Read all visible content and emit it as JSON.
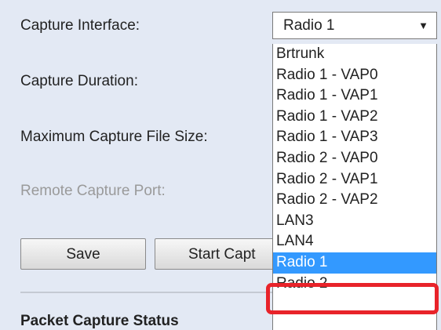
{
  "form": {
    "capture_interface_label": "Capture Interface:",
    "capture_duration_label": "Capture Duration:",
    "max_file_size_label": "Maximum Capture File Size:",
    "remote_port_label": "Remote Capture Port:"
  },
  "buttons": {
    "save": "Save",
    "start": "Start Capt"
  },
  "status": {
    "heading": "Packet Capture Status"
  },
  "select": {
    "value": "Radio 1",
    "arrow": "▼",
    "options": [
      "Brtrunk",
      "Radio 1 - VAP0",
      "Radio 1 - VAP1",
      "Radio 1 - VAP2",
      "Radio 1 - VAP3",
      "Radio 2 - VAP0",
      "Radio 2 - VAP1",
      "Radio 2 - VAP2",
      "LAN3",
      "LAN4",
      "Radio 1",
      "Radio 2"
    ],
    "highlighted_index": 10
  },
  "colors": {
    "page_bg": "#e3e9f4",
    "selected_bg": "#3399ff",
    "annotation_box": "#e8232a"
  }
}
